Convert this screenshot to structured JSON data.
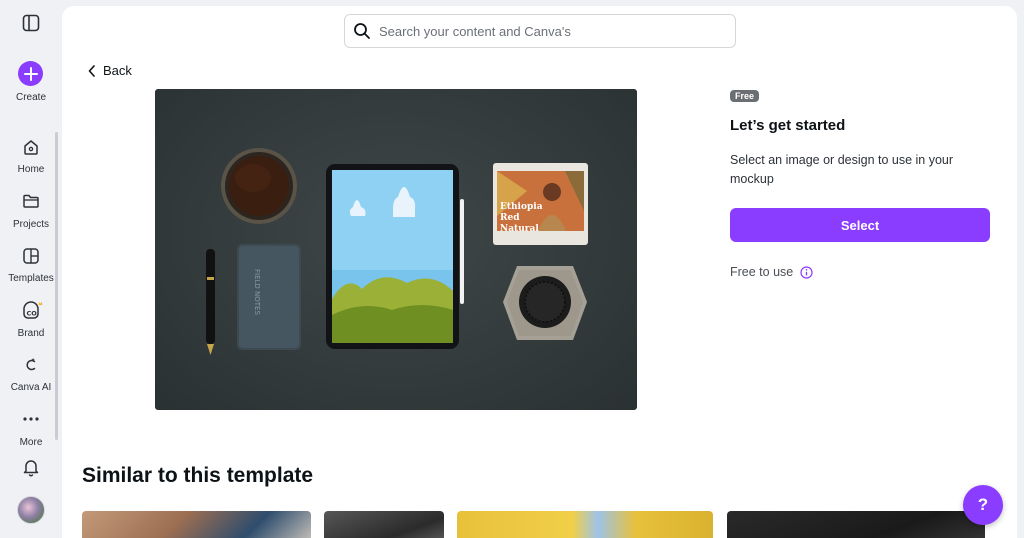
{
  "sidebar": {
    "create_label": "Create",
    "items": [
      {
        "label": "Home",
        "icon": "home-icon"
      },
      {
        "label": "Projects",
        "icon": "folder-icon"
      },
      {
        "label": "Templates",
        "icon": "templates-icon"
      },
      {
        "label": "Brand",
        "icon": "brand-icon"
      },
      {
        "label": "Canva AI",
        "icon": "canva-ai-icon"
      },
      {
        "label": "More",
        "icon": "more-icon"
      }
    ]
  },
  "search": {
    "placeholder": "Search your content and Canva's"
  },
  "back_label": "Back",
  "panel": {
    "badge": "Free",
    "title": "Let’s get started",
    "description": "Select an image or design to use in your mockup",
    "select_label": "Select",
    "free_to_use": "Free to use"
  },
  "preview": {
    "package_text_line1": "Ethiopia",
    "package_text_line2": "Red",
    "package_text_line3": "Natural",
    "notebook_text": "FIELD NOTES"
  },
  "similar": {
    "title": "Similar to this template"
  },
  "help_label": "?",
  "colors": {
    "accent": "#8b3dff",
    "badge": "#6b6f74",
    "background": "#f0f1f5"
  }
}
